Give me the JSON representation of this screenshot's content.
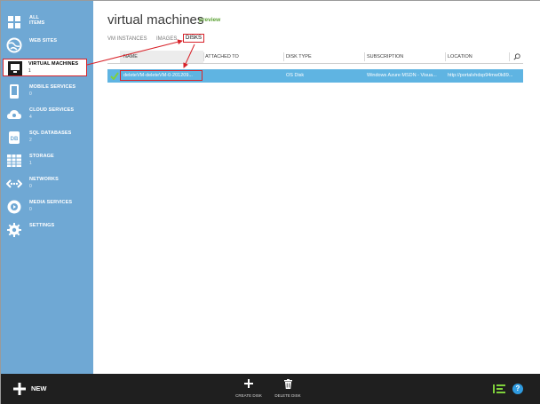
{
  "nav": {
    "items": [
      {
        "label_1": "ALL",
        "label_2": "ITEMS",
        "icon": "grid-icon"
      },
      {
        "label": "WEB SITES",
        "count": "",
        "icon": "globe-icon"
      },
      {
        "label": "VIRTUAL MACHINES",
        "count": "1",
        "icon": "monitor-icon"
      },
      {
        "label": "MOBILE SERVICES",
        "count": "0",
        "icon": "phone-icon"
      },
      {
        "label": "CLOUD SERVICES",
        "count": "4",
        "icon": "cloud-icon"
      },
      {
        "label": "SQL DATABASES",
        "count": "2",
        "icon": "database-icon"
      },
      {
        "label": "STORAGE",
        "count": "1",
        "icon": "table-icon"
      },
      {
        "label": "NETWORKS",
        "count": "0",
        "icon": "network-icon"
      },
      {
        "label": "MEDIA SERVICES",
        "count": "0",
        "icon": "media-icon"
      },
      {
        "label": "SETTINGS",
        "count": "",
        "icon": "gear-icon"
      }
    ]
  },
  "header": {
    "title": "virtual machines",
    "badge": "preview"
  },
  "tabs": [
    "VM INSTANCES",
    "IMAGES",
    "DISKS"
  ],
  "grid": {
    "columns": [
      "NAME",
      "ATTACHED TO",
      "DISK TYPE",
      "SUBSCRIPTION",
      "LOCATION"
    ],
    "rows": [
      {
        "name": "deleteVM-deleteVM-0-201209...",
        "attached_to": "",
        "disk_type": "OS Disk",
        "subscription": "Windows Azure MSDN - Visua...",
        "location": "http://portalvhdsp94mw0k89..."
      }
    ]
  },
  "bottom": {
    "new_label": "NEW",
    "create_disk": "CREATE DISK",
    "delete_disk": "DELETE DISK",
    "help": "?"
  },
  "colors": {
    "sidebar": "#6fa8d4",
    "row_selected": "#5fb4e2",
    "annotation_red": "#d8232a",
    "preview_green": "#5aa032",
    "bottom_bar": "#1f1f1f"
  }
}
